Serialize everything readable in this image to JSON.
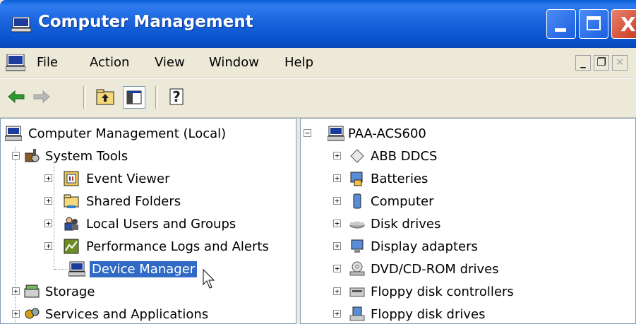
{
  "window": {
    "title": "Computer Management",
    "accent": "#0a54cf",
    "controls": {
      "minimize": "_",
      "maximize": "□",
      "close": "X"
    }
  },
  "menu": {
    "items": [
      "File",
      "Action",
      "View",
      "Window",
      "Help"
    ]
  },
  "toolbar": {
    "icons": [
      "back-arrow-icon",
      "forward-arrow-icon",
      "up-folder-icon",
      "show-hide-tree-icon",
      "help-icon"
    ]
  },
  "left_tree": {
    "root": "Computer Management (Local)",
    "system_tools": "System Tools",
    "children": [
      "Event Viewer",
      "Shared Folders",
      "Local Users and Groups",
      "Performance Logs and Alerts",
      "Device Manager"
    ],
    "storage": "Storage",
    "services": "Services and Applications"
  },
  "right_tree": {
    "root": "PAA-ACS600",
    "items": [
      "ABB DDCS",
      "Batteries",
      "Computer",
      "Disk drives",
      "Display adapters",
      "DVD/CD-ROM drives",
      "Floppy disk controllers",
      "Floppy disk drives"
    ]
  },
  "expanders": {
    "plus": "+",
    "minus": "−"
  },
  "selection_color": "#316ac5"
}
